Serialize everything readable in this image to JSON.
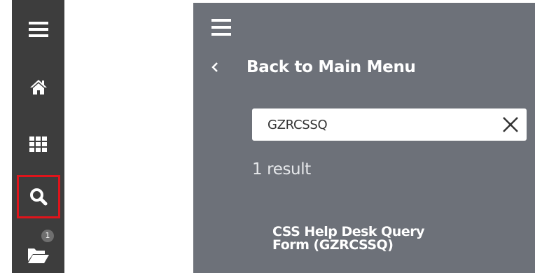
{
  "sidebar": {
    "items": [
      {
        "name": "menu",
        "icon": "hamburger-menu-icon"
      },
      {
        "name": "home",
        "icon": "home-icon"
      },
      {
        "name": "applications",
        "icon": "grid-icon"
      },
      {
        "name": "search",
        "icon": "search-icon",
        "highlighted": true
      },
      {
        "name": "recent",
        "icon": "folder-open-icon",
        "badge": "1"
      }
    ],
    "highlight_color": "#e0141b",
    "background": "#3d3d3d"
  },
  "panel": {
    "background": "#6d7179",
    "menu_icon": "hamburger-menu-icon",
    "back_label": "Back to Main Menu",
    "search": {
      "value": "GZRCSSQ",
      "clear_icon": "close-icon"
    },
    "result_count": "1 result",
    "results": [
      {
        "line1": "CSS Help Desk Query",
        "line2": "Form (GZRCSSQ)"
      }
    ]
  }
}
